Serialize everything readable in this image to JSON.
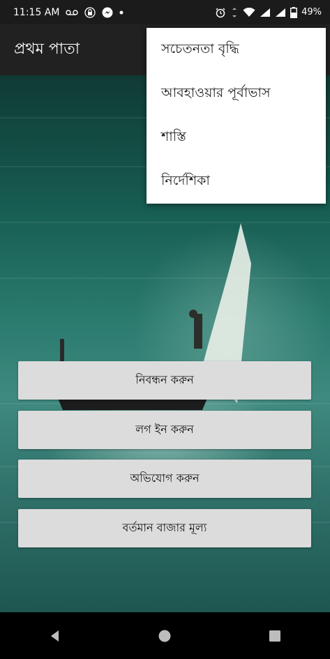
{
  "status_bar": {
    "time": "11:15 AM",
    "battery": "49%",
    "icons": [
      "voicemail-icon",
      "lock-icon",
      "messenger-icon",
      "dot-icon",
      "alarm-icon",
      "vibrate-icon",
      "wifi-icon",
      "signal-icon",
      "signal-icon",
      "battery-icon"
    ]
  },
  "app_bar": {
    "title": "প্রথম পাতা"
  },
  "menu": {
    "items": [
      {
        "label": "সচেতনতা বৃদ্ধি"
      },
      {
        "label": "আবহাওয়ার পূর্বাভাস"
      },
      {
        "label": "শাস্তি"
      },
      {
        "label": "নির্দেশিকা"
      }
    ]
  },
  "buttons": [
    {
      "label": "নিবন্ধন করুন"
    },
    {
      "label": "লগ ইন করুন"
    },
    {
      "label": "অভিযোগ করুন"
    },
    {
      "label": "বর্তমান বাজার মূল্য"
    }
  ],
  "nav_bar": {
    "icons": [
      "back-icon",
      "home-icon",
      "recents-icon"
    ]
  },
  "colors": {
    "status_bar": "#1b1b1b",
    "app_bar": "#212121",
    "button_bg": "#dcdcdc",
    "menu_bg": "#ffffff"
  }
}
